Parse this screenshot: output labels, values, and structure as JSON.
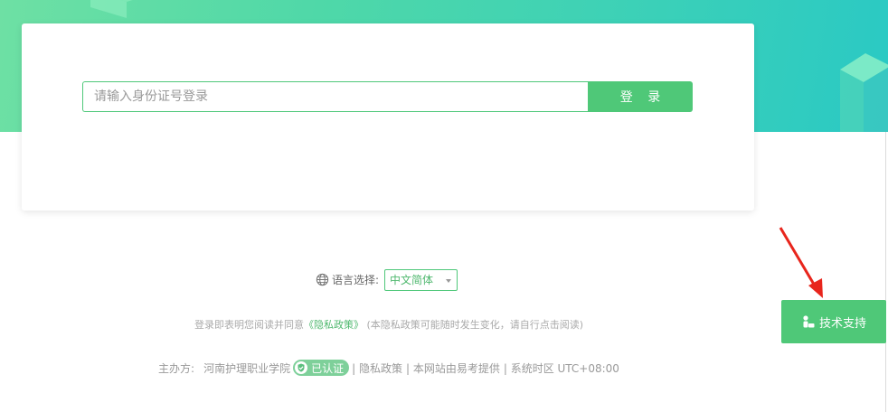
{
  "login": {
    "id_placeholder": "请输入身份证号登录",
    "login_button": "登 录"
  },
  "language": {
    "label": "语言选择:",
    "selected": "中文简体"
  },
  "agreement": {
    "prefix": "登录即表明您阅读并同意",
    "policy_link": "《隐私政策》",
    "suffix": "(本隐私政策可能随时发生变化，请自行点击阅读)"
  },
  "footer": {
    "host_label": "主办方:",
    "host_name": "河南护理职业学院",
    "verified_badge": "已认证",
    "privacy_link": "| 隐私政策",
    "provider": "| 本网站由易考提供",
    "timezone": "| 系统时区 UTC+08:00"
  },
  "support": {
    "button_label": "技术支持"
  },
  "icons": {
    "globe": "globe-icon",
    "verified": "shield-check-icon",
    "support": "person-icon",
    "annotation": "red-arrow-icon"
  },
  "colors": {
    "brand_green": "#4fc878",
    "hero_start": "#6ee0a4",
    "hero_end": "#2ac9c4",
    "annotation_red": "#e8251c"
  }
}
